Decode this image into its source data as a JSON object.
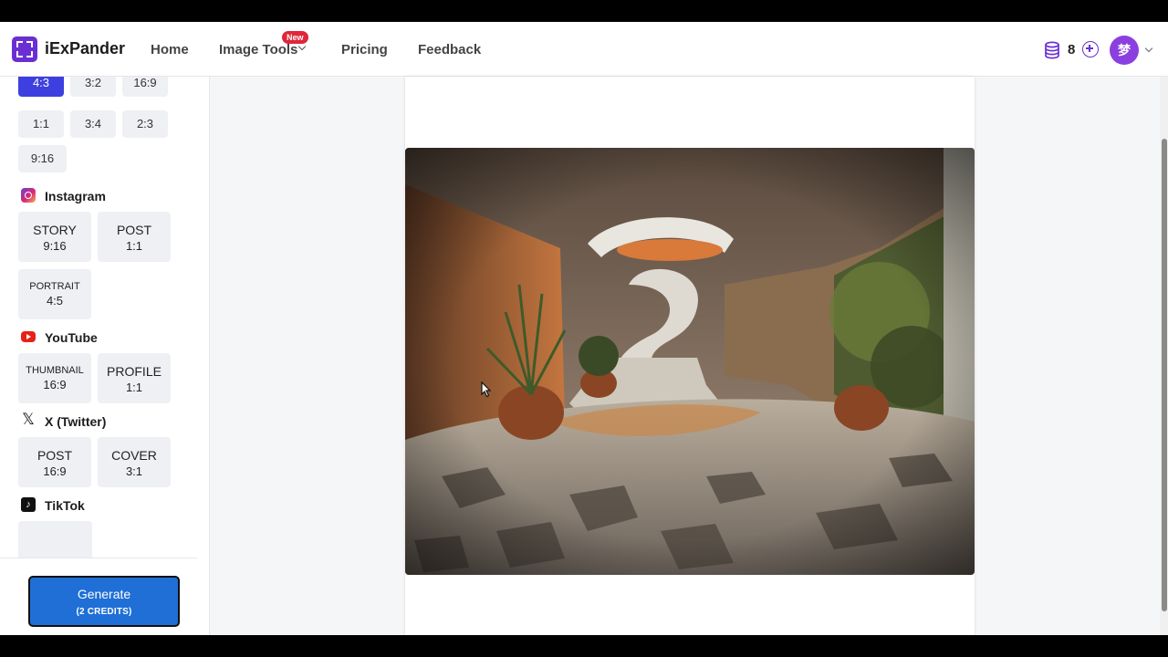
{
  "app": {
    "name": "iExPander"
  },
  "nav": {
    "home": "Home",
    "image_tools": "Image Tools",
    "image_tools_badge": "New",
    "pricing": "Pricing",
    "feedback": "Feedback"
  },
  "user": {
    "credits": "8",
    "avatar_initial": "梦"
  },
  "sidebar": {
    "ratios": [
      "4:3",
      "3:2",
      "16:9",
      "1:1",
      "3:4",
      "2:3",
      "9:16"
    ],
    "selected_ratio": "4:3",
    "instagram": {
      "label": "Instagram",
      "tiles": [
        {
          "name": "STORY",
          "ratio": "9:16"
        },
        {
          "name": "POST",
          "ratio": "1:1"
        },
        {
          "name": "PORTRAIT",
          "ratio": "4:5"
        }
      ]
    },
    "youtube": {
      "label": "YouTube",
      "tiles": [
        {
          "name": "THUMBNAIL",
          "ratio": "16:9"
        },
        {
          "name": "PROFILE",
          "ratio": "1:1"
        }
      ]
    },
    "twitter": {
      "label": "X (Twitter)",
      "tiles": [
        {
          "name": "POST",
          "ratio": "16:9"
        },
        {
          "name": "COVER",
          "ratio": "3:1"
        }
      ]
    },
    "tiktok": {
      "label": "TikTok"
    },
    "generate": {
      "label": "Generate",
      "credits": "(2 CREDITS)"
    }
  },
  "icons": {
    "logo": "expand-logo",
    "credits": "database-icon",
    "add": "plus-circle-icon",
    "cursor": "cursor-icon"
  },
  "colors": {
    "brand": "#6a2fd3",
    "selected": "#3d3fdf",
    "generate": "#1f6fd6",
    "new_badge": "#e0263a"
  }
}
